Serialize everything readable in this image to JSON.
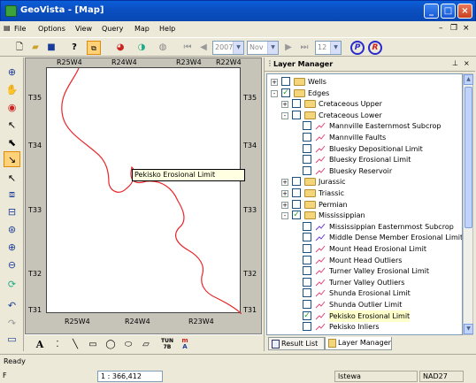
{
  "window": {
    "title": "GeoVista - [Map]"
  },
  "menu": [
    "File",
    "Options",
    "View",
    "Query",
    "Map",
    "Help"
  ],
  "toolbar": {
    "year_value": "2007",
    "month_value": "Nov",
    "num_value": "12",
    "p_label": "P",
    "r_label": "R"
  },
  "map": {
    "top_ranges": [
      "R25W4",
      "R24W4",
      "R23W4",
      "R22W4"
    ],
    "bottom_ranges": [
      "R25W4",
      "R24W4",
      "R23W4"
    ],
    "left_townships": [
      "T35",
      "T34",
      "T33",
      "T32",
      "T31"
    ],
    "right_townships": [
      "T35",
      "T34",
      "T33",
      "T32",
      "T31"
    ],
    "tooltip": "Pekisko Erosional Limit",
    "line_color": "#e8262b"
  },
  "drawbar": {
    "text_tool": "A",
    "coord_tool_top": "TUN",
    "coord_tool_bottom": "7B",
    "measure_top": "m",
    "measure_bottom": "A"
  },
  "layer_manager": {
    "title": "Layer Manager",
    "tree": [
      {
        "label": "Wells",
        "indent": 0,
        "type": "folder",
        "expander": "+",
        "checked": false
      },
      {
        "label": "Edges",
        "indent": 0,
        "type": "folder",
        "expander": "-",
        "checked": true
      },
      {
        "label": "Cretaceous Upper",
        "indent": 1,
        "type": "folder",
        "expander": "+",
        "checked": false
      },
      {
        "label": "Cretaceous Lower",
        "indent": 1,
        "type": "folder",
        "expander": "-",
        "checked": false
      },
      {
        "label": "Mannville Easternmost Subcrop",
        "indent": 2,
        "type": "line",
        "checked": false
      },
      {
        "label": "Mannville Faults",
        "indent": 2,
        "type": "line",
        "checked": false
      },
      {
        "label": "Bluesky Depositional Limit",
        "indent": 2,
        "type": "line",
        "checked": false
      },
      {
        "label": "Bluesky Erosional Limit",
        "indent": 2,
        "type": "line",
        "checked": false
      },
      {
        "label": "Bluesky Reservoir",
        "indent": 2,
        "type": "line",
        "checked": false
      },
      {
        "label": "Jurassic",
        "indent": 1,
        "type": "folder",
        "expander": "+",
        "checked": false
      },
      {
        "label": "Triassic",
        "indent": 1,
        "type": "folder",
        "expander": "+",
        "checked": false
      },
      {
        "label": "Permian",
        "indent": 1,
        "type": "folder",
        "expander": "+",
        "checked": false
      },
      {
        "label": "Mississippian",
        "indent": 1,
        "type": "folder",
        "expander": "-",
        "checked": true
      },
      {
        "label": "Mississippian Easternmost Subcrop",
        "indent": 2,
        "type": "line",
        "checked": false
      },
      {
        "label": "Middle Dense Member Erosional Limit",
        "indent": 2,
        "type": "line",
        "checked": false
      },
      {
        "label": "Mount Head Erosional Limit",
        "indent": 2,
        "type": "line",
        "checked": false
      },
      {
        "label": "Mount Head Outliers",
        "indent": 2,
        "type": "line",
        "checked": false
      },
      {
        "label": "Turner Valley Erosional Limit",
        "indent": 2,
        "type": "line",
        "checked": false
      },
      {
        "label": "Turner Valley Outliers",
        "indent": 2,
        "type": "line",
        "checked": false
      },
      {
        "label": "Shunda Erosional Limit",
        "indent": 2,
        "type": "line",
        "checked": false
      },
      {
        "label": "Shunda Outlier Limit",
        "indent": 2,
        "type": "line",
        "checked": false
      },
      {
        "label": "Pekisko Erosional Limit",
        "indent": 2,
        "type": "line",
        "checked": true,
        "selected": true
      },
      {
        "label": "Pekisko Inliers",
        "indent": 2,
        "type": "line",
        "checked": false
      }
    ],
    "tabs": [
      "Result List",
      "Layer Manager"
    ]
  },
  "status": {
    "ready": "Ready",
    "scale": "1 : 366,412",
    "projection": "lstewa",
    "datum": "NAD27",
    "f_label": "F"
  }
}
